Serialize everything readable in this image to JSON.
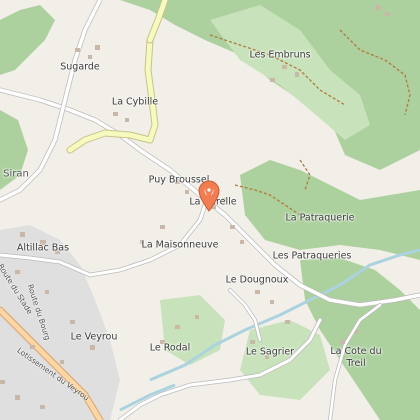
{
  "map": {
    "colors": {
      "land": "#f2efe9",
      "forest": "#add19e",
      "built": "#e0dfdf",
      "major_road": "#f7fabf",
      "secondary_road": "#fcd6a4",
      "stream": "#aad3df",
      "pin": "#f27d52"
    },
    "marker": {
      "icon": "map-pin-icon",
      "place": "La Carelle"
    },
    "places": [
      {
        "id": "sugarde",
        "name": "Sugarde"
      },
      {
        "id": "la-cybille",
        "name": "La Cybille"
      },
      {
        "id": "les-embruns",
        "name": "Les Embruns"
      },
      {
        "id": "siran",
        "name": "Siran"
      },
      {
        "id": "puy-broussel",
        "name": "Puy Broussel"
      },
      {
        "id": "la-carelle",
        "name": "La Carelle"
      },
      {
        "id": "la-patraquerie",
        "name": "La Patraquerie"
      },
      {
        "id": "altillac-bas",
        "name": "Altillac Bas"
      },
      {
        "id": "la-maisonneuve",
        "name": "La Maisonneuve"
      },
      {
        "id": "les-patraqueries",
        "name": "Les Patraqueries"
      },
      {
        "id": "le-dougnoux",
        "name": "Le Dougnoux"
      },
      {
        "id": "le-veyrou",
        "name": "Le Veyrou"
      },
      {
        "id": "le-rodal",
        "name": "Le Rodal"
      },
      {
        "id": "le-sagrier",
        "name": "Le Sagrier"
      },
      {
        "id": "la-cote-du-treil",
        "name": "La Cote du Treil"
      }
    ],
    "streets": [
      {
        "id": "route-du-stade",
        "name": "Route du Stade"
      },
      {
        "id": "route-du-bourg",
        "name": "Route du Bourg"
      },
      {
        "id": "lotissement-du-veyrou",
        "name": "Lotissement du Veyrou"
      }
    ]
  }
}
